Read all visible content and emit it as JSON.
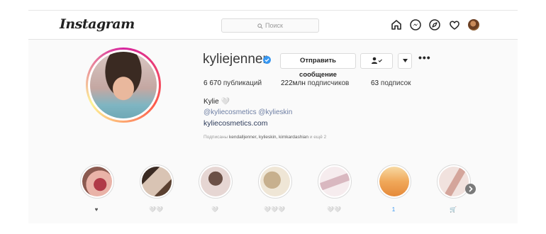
{
  "header": {
    "logo": "Instagram",
    "search_placeholder": "Поиск"
  },
  "icons": [
    "home-icon",
    "messenger-icon",
    "explore-icon",
    "heart-icon",
    "avatar"
  ],
  "profile": {
    "username": "kyliejenner",
    "message_button": "Отправить сообщение",
    "more": "•••",
    "stats": {
      "posts_num": "6 670",
      "posts_label": "публикаций",
      "followers_num": "222млн",
      "followers_label": "подписчиков",
      "following_num": "63",
      "following_label": "подписок"
    },
    "full_name": "Kylie 🤍",
    "bio_tags": "@kyliecosmetics @kylieskin",
    "link": "kyliecosmetics.com",
    "followed_by": {
      "prefix": "Подписаны",
      "names": "kendalljenner, kylieskin, kimkardashian",
      "suffix": "и ещё 2"
    }
  },
  "highlights": [
    {
      "label": "♥",
      "colors": [
        "#8b2f3a",
        "#e9b3a8"
      ]
    },
    {
      "label": "🤍🤍",
      "colors": [
        "#3a2a22",
        "#d9c4b4"
      ]
    },
    {
      "label": "🤍",
      "colors": [
        "#6b5046",
        "#e6d6d3"
      ]
    },
    {
      "label": "🤍🤍🤍",
      "colors": [
        "#c7b08e",
        "#efe6d6"
      ]
    },
    {
      "label": "🤍🤍",
      "colors": [
        "#d9b8c0",
        "#f6ecee"
      ]
    },
    {
      "label": "1",
      "colors": [
        "#f0a85a",
        "#f7d9a3"
      ]
    },
    {
      "label": "🛒",
      "colors": [
        "#d4a59b",
        "#f1e2de"
      ]
    }
  ],
  "colors": {
    "accent_blue": "#3897f0",
    "text_dark": "#262626",
    "border": "#dbdbdb"
  }
}
